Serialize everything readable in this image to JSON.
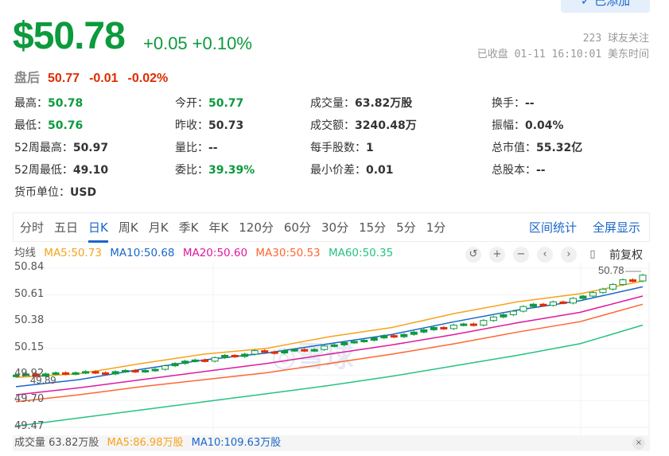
{
  "header": {
    "follow_button": "✓ 已添加",
    "price": "$50.78",
    "change": "+0.05",
    "change_pct": "+0.10%",
    "followers": "223 球友关注",
    "status": "已收盘 01-11 16:10:01 美东时间",
    "after_hours": {
      "label": "盘后",
      "price": "50.77",
      "change": "-0.01",
      "change_pct": "-0.02%"
    }
  },
  "stats": [
    {
      "label": "最高：",
      "value": "50.78",
      "color": "green"
    },
    {
      "label": "今开：",
      "value": "50.77",
      "color": "green"
    },
    {
      "label": "成交量：",
      "value": "63.82万股"
    },
    {
      "label": "换手：",
      "value": "--"
    },
    {
      "label": "最低：",
      "value": "50.76",
      "color": "green"
    },
    {
      "label": "昨收：",
      "value": "50.73"
    },
    {
      "label": "成交额：",
      "value": "3240.48万"
    },
    {
      "label": "振幅：",
      "value": "0.04%"
    },
    {
      "label": "52周最高：",
      "value": "50.97"
    },
    {
      "label": "量比：",
      "value": "--"
    },
    {
      "label": "每手股数：",
      "value": "1"
    },
    {
      "label": "总市值：",
      "value": "55.32亿"
    },
    {
      "label": "52周最低：",
      "value": "49.10"
    },
    {
      "label": "委比：",
      "value": "39.39%",
      "color": "green"
    },
    {
      "label": "最小价差：",
      "value": "0.01"
    },
    {
      "label": "总股本：",
      "value": "--"
    },
    {
      "label": "货币单位：",
      "value": "USD"
    }
  ],
  "tabs": [
    "分时",
    "五日",
    "日K",
    "周K",
    "月K",
    "季K",
    "年K",
    "120分",
    "60分",
    "30分",
    "15分",
    "5分",
    "1分"
  ],
  "active_tab": "日K",
  "tab_actions": [
    "区间统计",
    "全屏显示"
  ],
  "ma_legend": {
    "label": "均线",
    "ma5": "MA5:50.73",
    "ma10": "MA10:50.68",
    "ma20": "MA20:50.60",
    "ma30": "MA30:50.53",
    "ma60": "MA60:50.35"
  },
  "controls": {
    "adjust": "前复权"
  },
  "colors": {
    "up": "#0c9a3d",
    "down": "#e02c00",
    "ma5": "#f7a21b",
    "ma10": "#1a66c9",
    "ma20": "#e0199e",
    "ma30": "#ff6633",
    "ma60": "#26c281"
  },
  "chart_data": {
    "type": "candlestick",
    "ylim": [
      49.47,
      50.84
    ],
    "yticks": [
      "50.84",
      "50.61",
      "50.38",
      "50.15",
      "49.92",
      "49.70",
      "49.47"
    ],
    "last_label": "50.78",
    "low_label": "49.89",
    "closes": [
      49.92,
      49.93,
      49.91,
      49.93,
      49.94,
      49.93,
      49.94,
      49.95,
      49.94,
      49.93,
      49.95,
      49.96,
      49.95,
      49.96,
      49.97,
      50.0,
      50.02,
      50.04,
      50.05,
      50.04,
      50.07,
      50.09,
      50.08,
      50.1,
      50.13,
      50.12,
      50.11,
      50.13,
      50.14,
      50.13,
      50.14,
      50.17,
      50.18,
      50.2,
      50.21,
      50.22,
      50.24,
      50.26,
      50.25,
      50.27,
      50.29,
      50.31,
      50.33,
      50.32,
      50.35,
      50.36,
      50.35,
      50.39,
      50.42,
      50.44,
      50.47,
      50.51,
      50.53,
      50.52,
      50.55,
      50.54,
      50.58,
      50.6,
      50.63,
      50.66,
      50.7,
      50.74,
      50.73,
      50.78
    ],
    "ma": {
      "ma5": [
        49.9,
        49.93,
        50.02,
        50.1,
        50.15,
        50.25,
        50.33,
        50.45,
        50.55,
        50.62,
        50.73
      ],
      "ma10": [
        49.82,
        49.88,
        49.97,
        50.05,
        50.11,
        50.19,
        50.27,
        50.38,
        50.48,
        50.56,
        50.68
      ],
      "ma20": [
        49.75,
        49.81,
        49.88,
        49.95,
        50.02,
        50.1,
        50.18,
        50.27,
        50.37,
        50.46,
        50.6
      ],
      "ma30": [
        49.69,
        49.75,
        49.82,
        49.88,
        49.94,
        50.02,
        50.1,
        50.19,
        50.29,
        50.38,
        50.53
      ],
      "ma60": [
        49.48,
        49.55,
        49.62,
        49.69,
        49.76,
        49.83,
        49.91,
        50.0,
        50.09,
        50.19,
        50.35
      ]
    }
  },
  "volume": {
    "label": "成交量 63.82万股",
    "ma5": "MA5:86.98万股",
    "ma10": "MA10:109.63万股",
    "close": "×"
  }
}
